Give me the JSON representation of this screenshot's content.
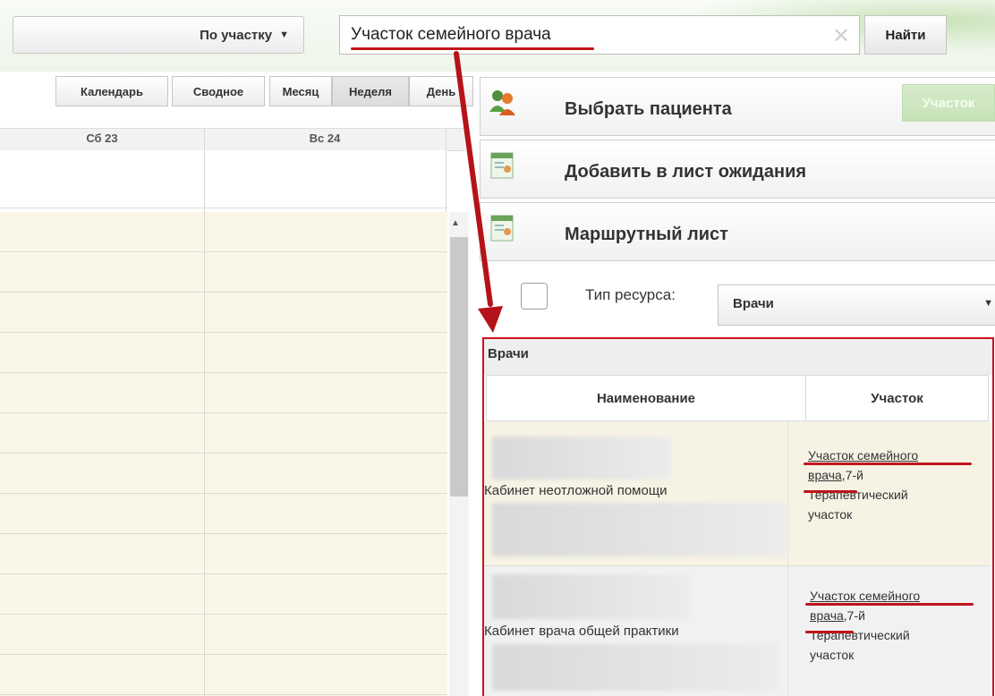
{
  "header": {
    "mode_select": "По участку",
    "search_value": "Участок семейного врача",
    "find_button": "Найти"
  },
  "view_buttons": {
    "calendar": "Календарь",
    "summary": "Сводное",
    "month": "Месяц",
    "week": "Неделя",
    "day": "День"
  },
  "calendar": {
    "columns": [
      "Сб 23",
      "Вс 24"
    ]
  },
  "actions": {
    "select_patient": "Выбрать пациента",
    "uchastok_button": "Участок",
    "add_to_waitlist": "Добавить в лист ожидания",
    "route_sheet": "Маршрутный лист"
  },
  "filters": {
    "resource_type_label": "Тип ресурса:",
    "resource_type_value": "Врачи"
  },
  "doctors": {
    "title": "Врачи",
    "columns": {
      "name": "Наименование",
      "uchastok": "Участок"
    },
    "rows": [
      {
        "room": "Кабинет неотложной помощи",
        "uchastok_link1": "Участок семейного",
        "uchastok_link2": "врача",
        "uchastok_rest1": ",7-й",
        "uchastok_rest2": "Терапевтический",
        "uchastok_rest3": "участок"
      },
      {
        "room": "Кабинет врача общей практики",
        "uchastok_link1": "Участок семейного",
        "uchastok_link2": "врача",
        "uchastok_rest1": ",7-й",
        "uchastok_rest2": "Терапевтический",
        "uchastok_rest3": "участок"
      }
    ]
  },
  "colors": {
    "annotation_red": "#c0141b",
    "accent_green": "#c7e2b8"
  }
}
